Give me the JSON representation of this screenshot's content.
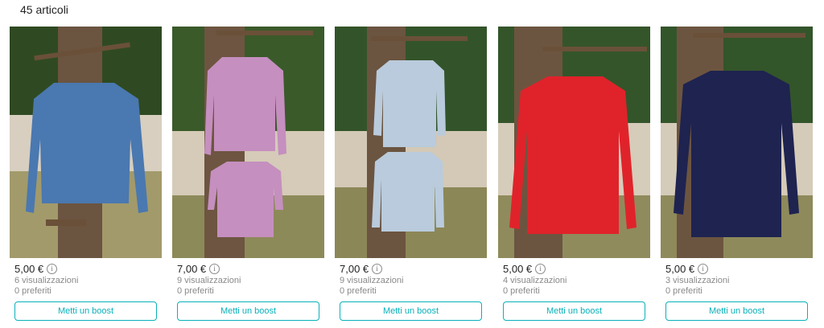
{
  "header": {
    "count_label": "45 articoli"
  },
  "colors": {
    "accent": "#09b1ba",
    "muted_text": "#8a8a8a"
  },
  "items": [
    {
      "price": "5,00 €",
      "views": "6 visualizzazioni",
      "favorites": "0 preferiti",
      "boost_label": "Metti un boost",
      "garment_color": "#4a78b0"
    },
    {
      "price": "7,00 €",
      "views": "9 visualizzazioni",
      "favorites": "0 preferiti",
      "boost_label": "Metti un boost",
      "garment_color": "#c58fbf"
    },
    {
      "price": "7,00 €",
      "views": "9 visualizzazioni",
      "favorites": "0 preferiti",
      "boost_label": "Metti un boost",
      "garment_color": "#b9cbdc"
    },
    {
      "price": "5,00 €",
      "views": "4 visualizzazioni",
      "favorites": "0 preferiti",
      "boost_label": "Metti un boost",
      "garment_color": "#e0232b"
    },
    {
      "price": "5,00 €",
      "views": "3 visualizzazioni",
      "favorites": "0 preferiti",
      "boost_label": "Metti un boost",
      "garment_color": "#1e2350"
    }
  ]
}
